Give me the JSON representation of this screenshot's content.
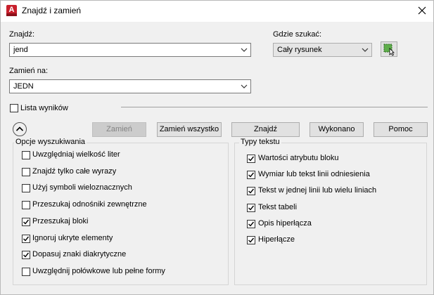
{
  "window": {
    "title": "Znajdź i zamień"
  },
  "find": {
    "label": "Znajdź:",
    "value": "jend"
  },
  "where": {
    "label": "Gdzie szukać:",
    "value": "Cały rysunek"
  },
  "replace": {
    "label": "Zamień na:",
    "value": "JEDN"
  },
  "results": {
    "label": "Lista wyników",
    "checked": false
  },
  "buttons": {
    "replace": "Zamień",
    "replace_all": "Zamień wszystko",
    "find": "Znajdź",
    "done": "Wykonano",
    "help": "Pomoc"
  },
  "search_options": {
    "title": "Opcje wyszukiwania",
    "items": [
      {
        "label": "Uwzględniaj wielkość liter",
        "checked": false
      },
      {
        "label": "Znajdź tylko całe wyrazy",
        "checked": false
      },
      {
        "label": "Użyj symboli wieloznacznych",
        "checked": false
      },
      {
        "label": "Przeszukaj odnośniki zewnętrzne",
        "checked": false
      },
      {
        "label": "Przeszukaj bloki",
        "checked": true
      },
      {
        "label": "Ignoruj ukryte elementy",
        "checked": true
      },
      {
        "label": "Dopasuj znaki diakrytyczne",
        "checked": true
      },
      {
        "label": "Uwzględnij połówkowe lub pełne formy",
        "checked": false
      }
    ]
  },
  "text_types": {
    "title": "Typy tekstu",
    "items": [
      {
        "label": "Wartości atrybutu bloku",
        "checked": true
      },
      {
        "label": "Wymiar lub tekst linii odniesienia",
        "checked": true
      },
      {
        "label": "Tekst w jednej linii lub wielu liniach",
        "checked": true
      },
      {
        "label": "Tekst tabeli",
        "checked": true
      },
      {
        "label": "Opis hiperłącza",
        "checked": true
      },
      {
        "label": "Hiperłącze",
        "checked": true
      }
    ]
  }
}
